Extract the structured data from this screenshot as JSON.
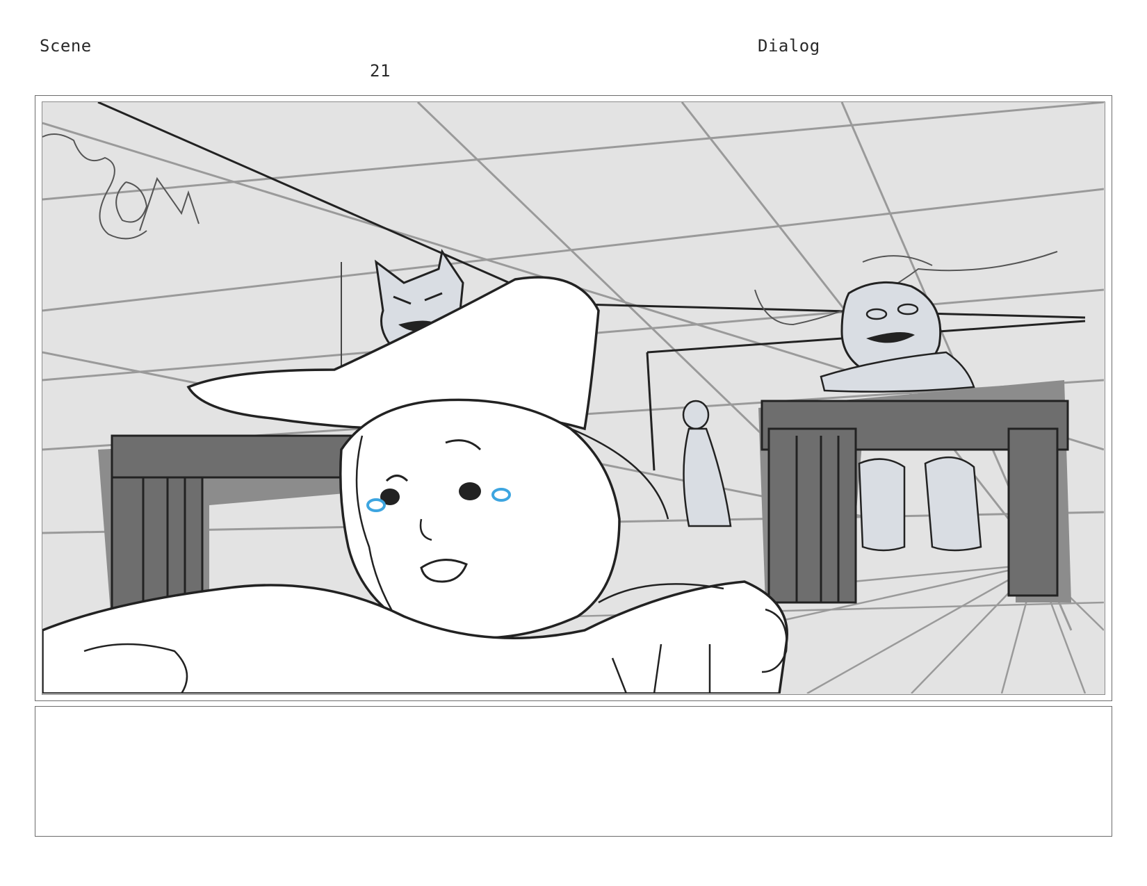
{
  "header": {
    "scene_label": "Scene",
    "dialog_label": "Dialog",
    "panel_number": "21"
  },
  "panel": {
    "notes": ""
  },
  "colors": {
    "background": "#e3e3e3",
    "line": "#222222",
    "guide_line": "#9a9a9a",
    "desk_gray": "#6e6e6e",
    "shadow_gray": "#8c8c8c",
    "tear_blue": "#3da5e0",
    "character_fill": "#ffffff",
    "minor_figure_fill": "#d9dde3"
  },
  "icons": {
    "scene_art": "storyboard-sketch-crying-witch-in-classroom"
  }
}
